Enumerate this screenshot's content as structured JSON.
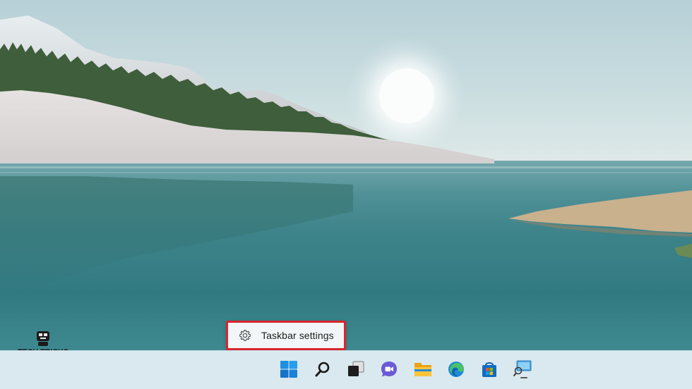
{
  "context_menu": {
    "items": [
      {
        "label": "Taskbar settings",
        "icon": "gear-icon"
      }
    ],
    "highlight_color": "#d9252e"
  },
  "watermark": {
    "title": "TECH TRICKS",
    "subtitle": "THỦ THUẬT CÔNG NGHỆ"
  },
  "taskbar": {
    "icons": [
      "windows-start-icon",
      "search-icon",
      "task-view-icon",
      "chat-icon",
      "file-explorer-icon",
      "edge-icon",
      "microsoft-store-icon",
      "remote-desktop-icon"
    ]
  },
  "colors": {
    "taskbar_bg": "#d9e9ef",
    "accent_blue": "#0a78d4"
  }
}
